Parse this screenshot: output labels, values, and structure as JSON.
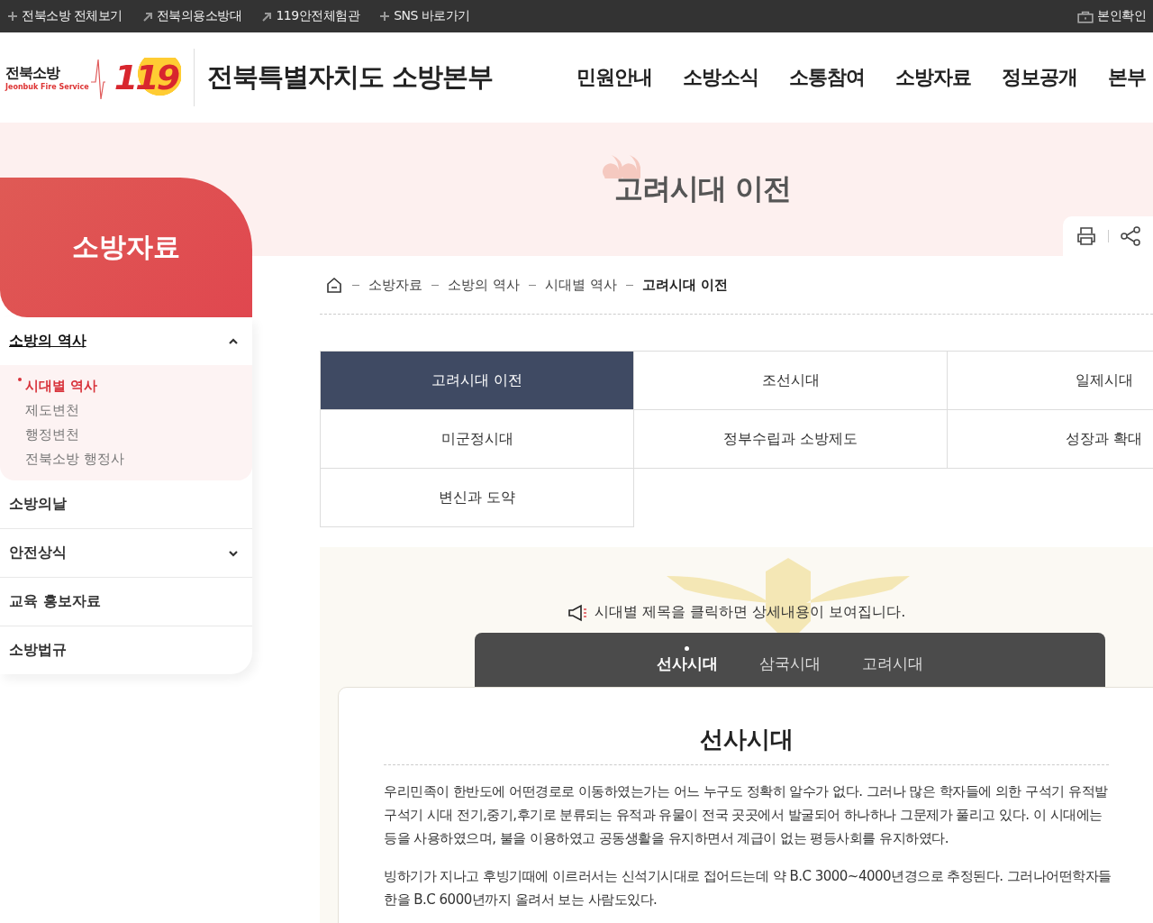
{
  "top_links": [
    {
      "kind": "expand",
      "label": "전북소방 전체보기"
    },
    {
      "kind": "external",
      "label": "전북의용소방대"
    },
    {
      "kind": "external",
      "label": "119안전체험관"
    },
    {
      "kind": "expand",
      "label": "SNS 바로가기"
    }
  ],
  "verify_link": "본인확인",
  "logo": {
    "name": "전북소방",
    "subtitle": "Jeonbuk Fire Service",
    "number": "119"
  },
  "site_title": "전북특별자치도 소방본부",
  "nav": [
    "민원안내",
    "소방소식",
    "소통참여",
    "소방자료",
    "정보공개",
    "본부"
  ],
  "sidebar": {
    "title": "소방자료",
    "items": [
      {
        "kind": "group",
        "label": "소방의 역사",
        "selected": true,
        "expanded": true,
        "children": [
          {
            "label": "시대별 역사",
            "selected": true
          },
          {
            "label": "제도변천",
            "selected": false
          },
          {
            "label": "행정변천",
            "selected": false
          },
          {
            "label": "전북소방 행정사",
            "selected": false
          }
        ]
      },
      {
        "kind": "link",
        "label": "소방의날",
        "selected": false
      },
      {
        "kind": "group",
        "label": "안전상식",
        "selected": false,
        "expanded": false
      },
      {
        "kind": "link",
        "label": "교육 홍보자료",
        "selected": false
      },
      {
        "kind": "link",
        "label": "소방법규",
        "selected": false
      }
    ]
  },
  "page_title": "고려시대 이전",
  "breadcrumb": [
    "소방자료",
    "소방의 역사",
    "시대별 역사",
    "고려시대 이전"
  ],
  "era_tabs": [
    {
      "label": "고려시대 이전",
      "selected": true
    },
    {
      "label": "조선시대",
      "selected": false
    },
    {
      "label": "일제시대",
      "selected": false
    },
    {
      "label": "미군정시대",
      "selected": false
    },
    {
      "label": "정부수립과 소방제도",
      "selected": false
    },
    {
      "label": "성장과 확대",
      "selected": false
    },
    {
      "label": "변신과 도약",
      "selected": false
    }
  ],
  "notice": "시대별 제목을 클릭하면 상세내용이 보여집니다.",
  "period_tabs": [
    {
      "label": "선사시대",
      "selected": true
    },
    {
      "label": "삼국시대",
      "selected": false
    },
    {
      "label": "고려시대",
      "selected": false
    }
  ],
  "article": {
    "heading": "선사시대",
    "paragraphs": [
      [
        "우리민족이 한반도에 어떤경로로 이동하였는가는 어느 누구도 정확히 알수가 없다. 그러나 많은 학자들에 의한 구석기 유적발",
        "구석기 시대 전기,중기,후기로 분류되는 유적과 유물이 전국 곳곳에서 발굴되어 하나하나 그문제가 풀리고 있다. 이 시대에는",
        "등을 사용하였으며, 불을 이용하였고 공동생활을 유지하면서 계급이 없는 평등사회를 유지하였다."
      ],
      [
        "빙하기가 지나고 후빙기때에 이르러서는 신석기시대로 접어드는데 약 B.C 3000~4000년경으로 추정된다. 그러나어떤학자들",
        "한을 B.C 6000년까지 올려서 보는 사람도있다."
      ]
    ]
  }
}
